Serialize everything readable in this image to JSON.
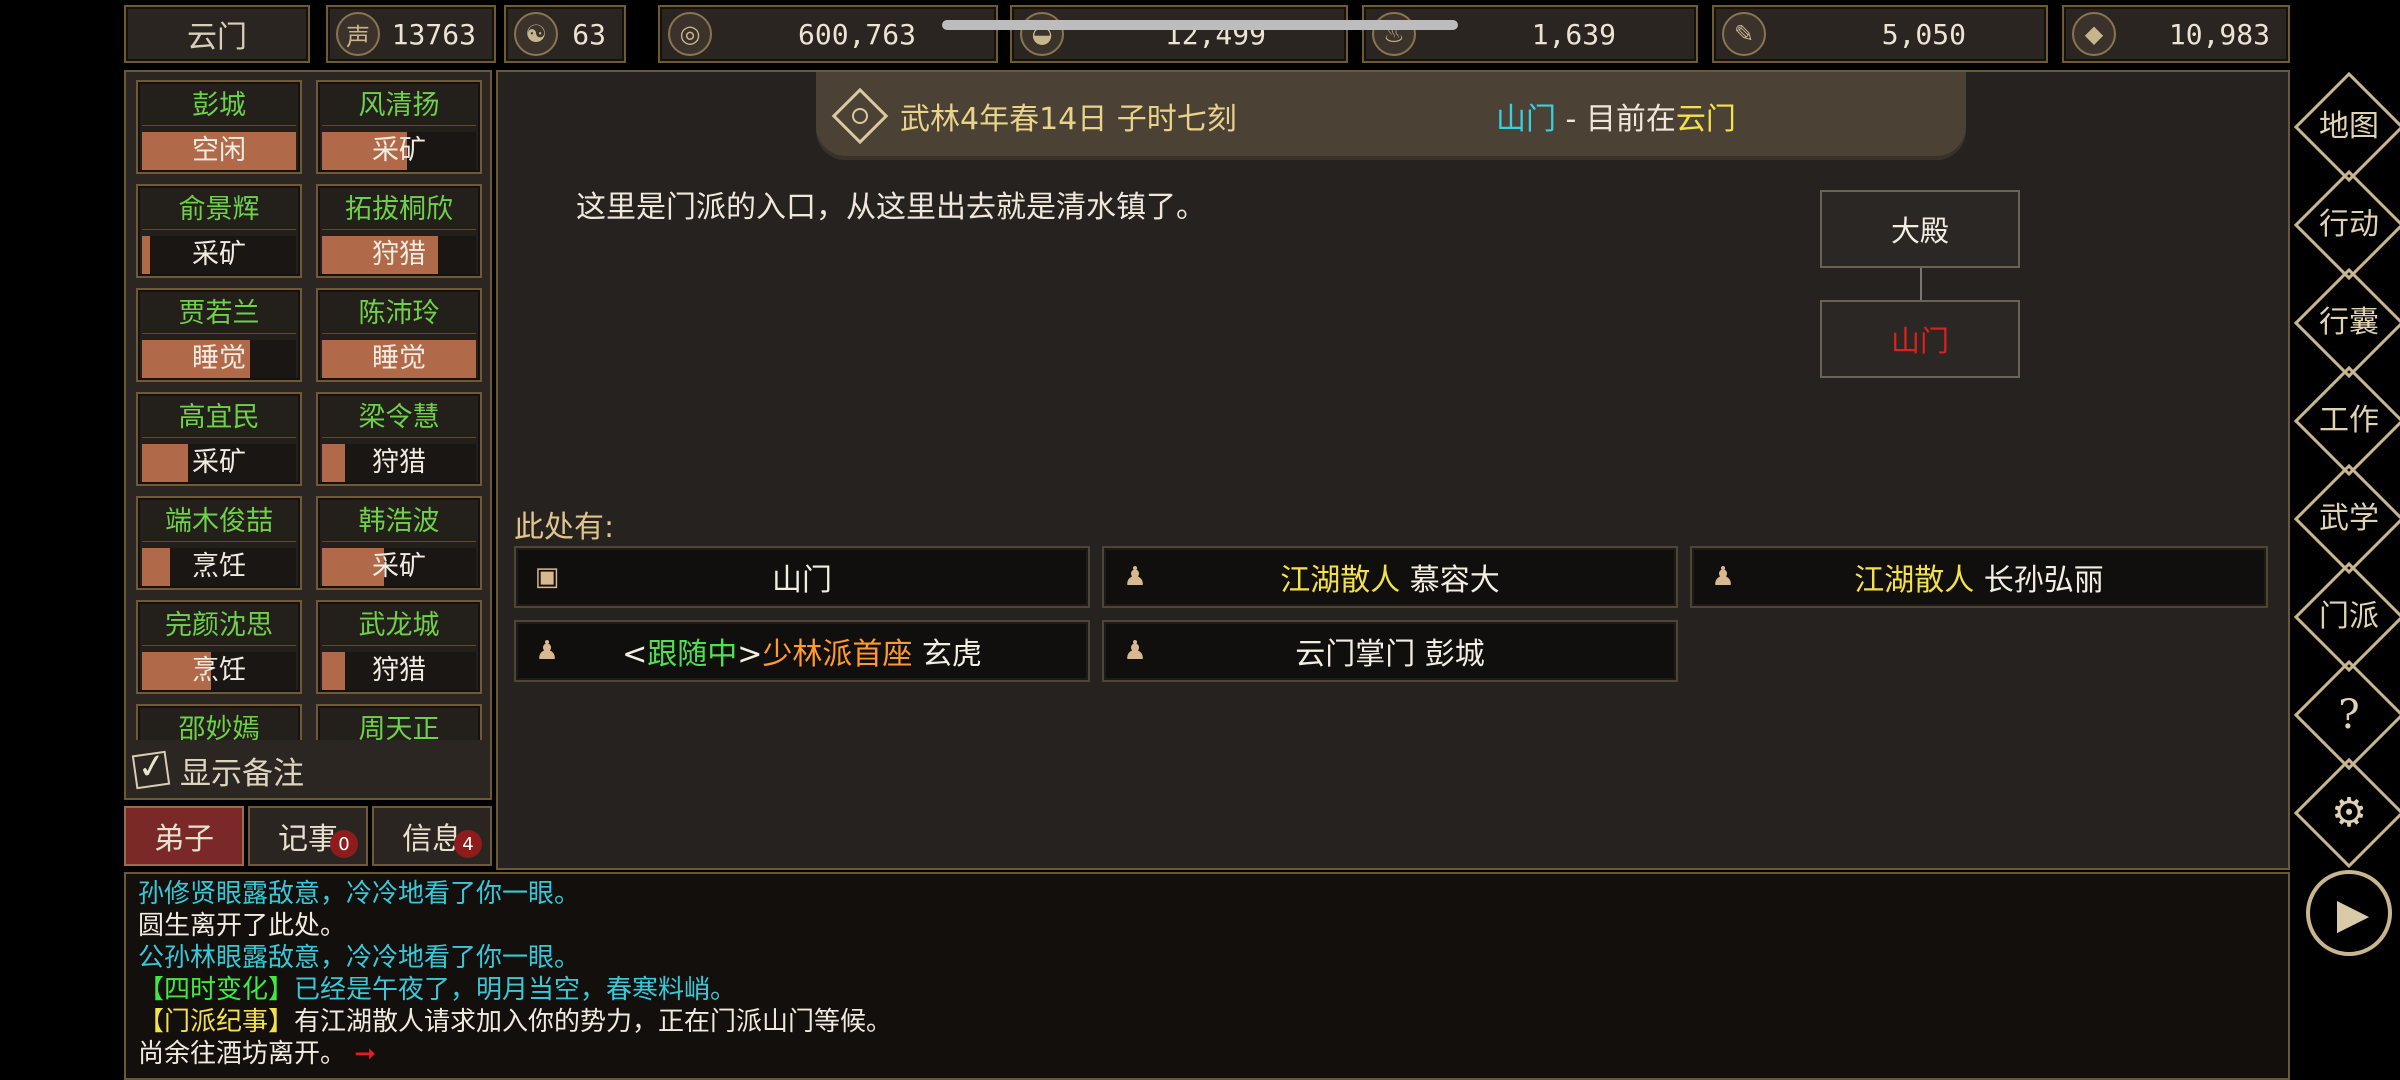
{
  "topbar": {
    "sect_name": "云门",
    "resources": [
      {
        "icon": "reputation-icon",
        "glyph": "声",
        "value": "13763"
      },
      {
        "icon": "yin-yang-icon",
        "glyph": "☯",
        "value": "63"
      },
      {
        "icon": "coin-icon",
        "glyph": "◎",
        "value": "600,763"
      },
      {
        "icon": "food-bowl-icon",
        "glyph": "◒",
        "value": "12,499"
      },
      {
        "icon": "herb-icon",
        "glyph": "♨",
        "value": "1,639"
      },
      {
        "icon": "wood-icon",
        "glyph": "✎",
        "value": "5,050"
      },
      {
        "icon": "ore-icon",
        "glyph": "◆",
        "value": "10,983"
      }
    ]
  },
  "disciples": [
    {
      "name": "彭城",
      "task": "空闲",
      "progress": 1.0
    },
    {
      "name": "风清扬",
      "task": "采矿",
      "progress": 0.55
    },
    {
      "name": "俞景辉",
      "task": "采矿",
      "progress": 0.05
    },
    {
      "name": "拓拔桐欣",
      "task": "狩猎",
      "progress": 0.75
    },
    {
      "name": "贾若兰",
      "task": "睡觉",
      "progress": 0.7
    },
    {
      "name": "陈沛玲",
      "task": "睡觉",
      "progress": 1.0
    },
    {
      "name": "高宜民",
      "task": "采矿",
      "progress": 0.3
    },
    {
      "name": "梁令慧",
      "task": "狩猎",
      "progress": 0.15
    },
    {
      "name": "端木俊喆",
      "task": "烹饪",
      "progress": 0.18
    },
    {
      "name": "韩浩波",
      "task": "采矿",
      "progress": 0.4
    },
    {
      "name": "完颜沈思",
      "task": "烹饪",
      "progress": 0.45
    },
    {
      "name": "武龙城",
      "task": "狩猎",
      "progress": 0.15
    },
    {
      "name": "邵妙嫣",
      "task": "",
      "progress": 0
    },
    {
      "name": "周天正",
      "task": "",
      "progress": 0
    }
  ],
  "show_notes_label": "显示备注",
  "tabs": {
    "disciples": "弟子",
    "records": "记事",
    "records_badge": "0",
    "info": "信息",
    "info_badge": "4"
  },
  "banner": {
    "date": "武林4年春14日 子时七刻",
    "location": "山门",
    "separator": " - 目前在",
    "sect": "云门"
  },
  "description": "这里是门派的入口，从这里出去就是清水镇了。",
  "minimap": {
    "upper": "大殿",
    "current": "山门"
  },
  "here_label": "此处有:",
  "entities": {
    "gate": "山门",
    "npc1_title": "江湖散人",
    "npc1_name": "慕容大",
    "npc2_title": "江湖散人",
    "npc2_name": "长孙弘丽",
    "follow_open": "<",
    "follow_status": "跟随中",
    "follow_close": ">",
    "npc3_title": "少林派首座",
    "npc3_name": "玄虎",
    "npc4": "云门掌门 彭城"
  },
  "menu": [
    "地图",
    "行动",
    "行囊",
    "工作",
    "武学",
    "门派"
  ],
  "log": [
    {
      "text": "孙修贤眼露敌意，冷冷地看了你一眼。",
      "color": "#38c8d8"
    },
    {
      "text": "圆生离开了此处。",
      "color": "#f0ebe0"
    },
    {
      "text": "公孙林眼露敌意，冷冷地看了你一眼。",
      "color": "#38c8d8"
    }
  ],
  "log_tags": {
    "season_tag": "【四时变化】",
    "season_text": "已经是午夜了，明月当空，春寒料峭。",
    "sect_tag": "【门派纪事】",
    "sect_text": "有江湖散人请求加入你的势力，正在门派山门等候。",
    "last": "尚余往酒坊离开。"
  },
  "colors": {
    "accent_gold": "#e9d28a",
    "name_green": "#6fd04a",
    "npc_yellow": "#f3e14a",
    "cyan": "#38c8d8",
    "orange": "#ff9a2e",
    "red": "#e02020"
  }
}
